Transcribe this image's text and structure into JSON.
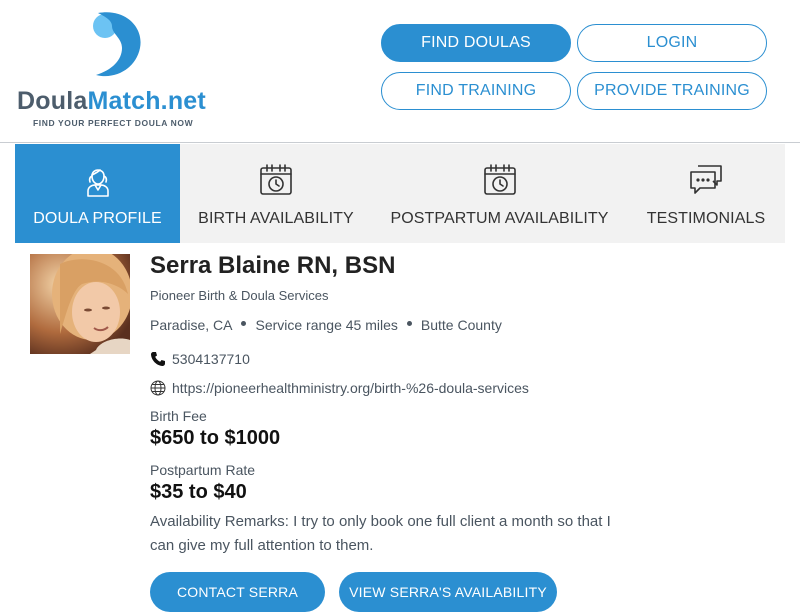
{
  "header": {
    "logo_word_1": "Doula",
    "logo_word_2": "Match.net",
    "tagline": "FIND YOUR PERFECT DOULA NOW",
    "nav": {
      "find_doulas": "FIND DOULAS",
      "login": "LOGIN",
      "find_training": "FIND TRAINING",
      "provide_training": "PROVIDE TRAINING"
    }
  },
  "tabs": [
    {
      "label": "DOULA PROFILE",
      "icon": "doula-person-icon",
      "active": true
    },
    {
      "label": "BIRTH AVAILABILITY",
      "icon": "calendar-clock-icon",
      "active": false
    },
    {
      "label": "POSTPARTUM AVAILABILITY",
      "icon": "calendar-clock-icon",
      "active": false
    },
    {
      "label": "TESTIMONIALS",
      "icon": "chat-bubbles-icon",
      "active": false
    }
  ],
  "profile": {
    "name": "Serra Blaine RN, BSN",
    "organization": "Pioneer Birth & Doula Services",
    "city": "Paradise, CA",
    "service_range": "Service range 45 miles",
    "county": "Butte County",
    "phone": "5304137710",
    "website": "https://pioneerhealthministry.org/birth-%26-doula-services",
    "birth_fee_label": "Birth Fee",
    "birth_fee": "$650 to $1000",
    "postpartum_label": "Postpartum Rate",
    "postpartum_rate": "$35 to $40",
    "remarks": "Availability Remarks: I try to only book one full client a month so that I can give my full attention to them."
  },
  "actions": {
    "contact": "CONTACT SERRA",
    "availability": "VIEW SERRA'S AVAILABILITY"
  },
  "colors": {
    "brand_blue": "#2b8fd1",
    "tab_bg": "#f2f2f2"
  }
}
